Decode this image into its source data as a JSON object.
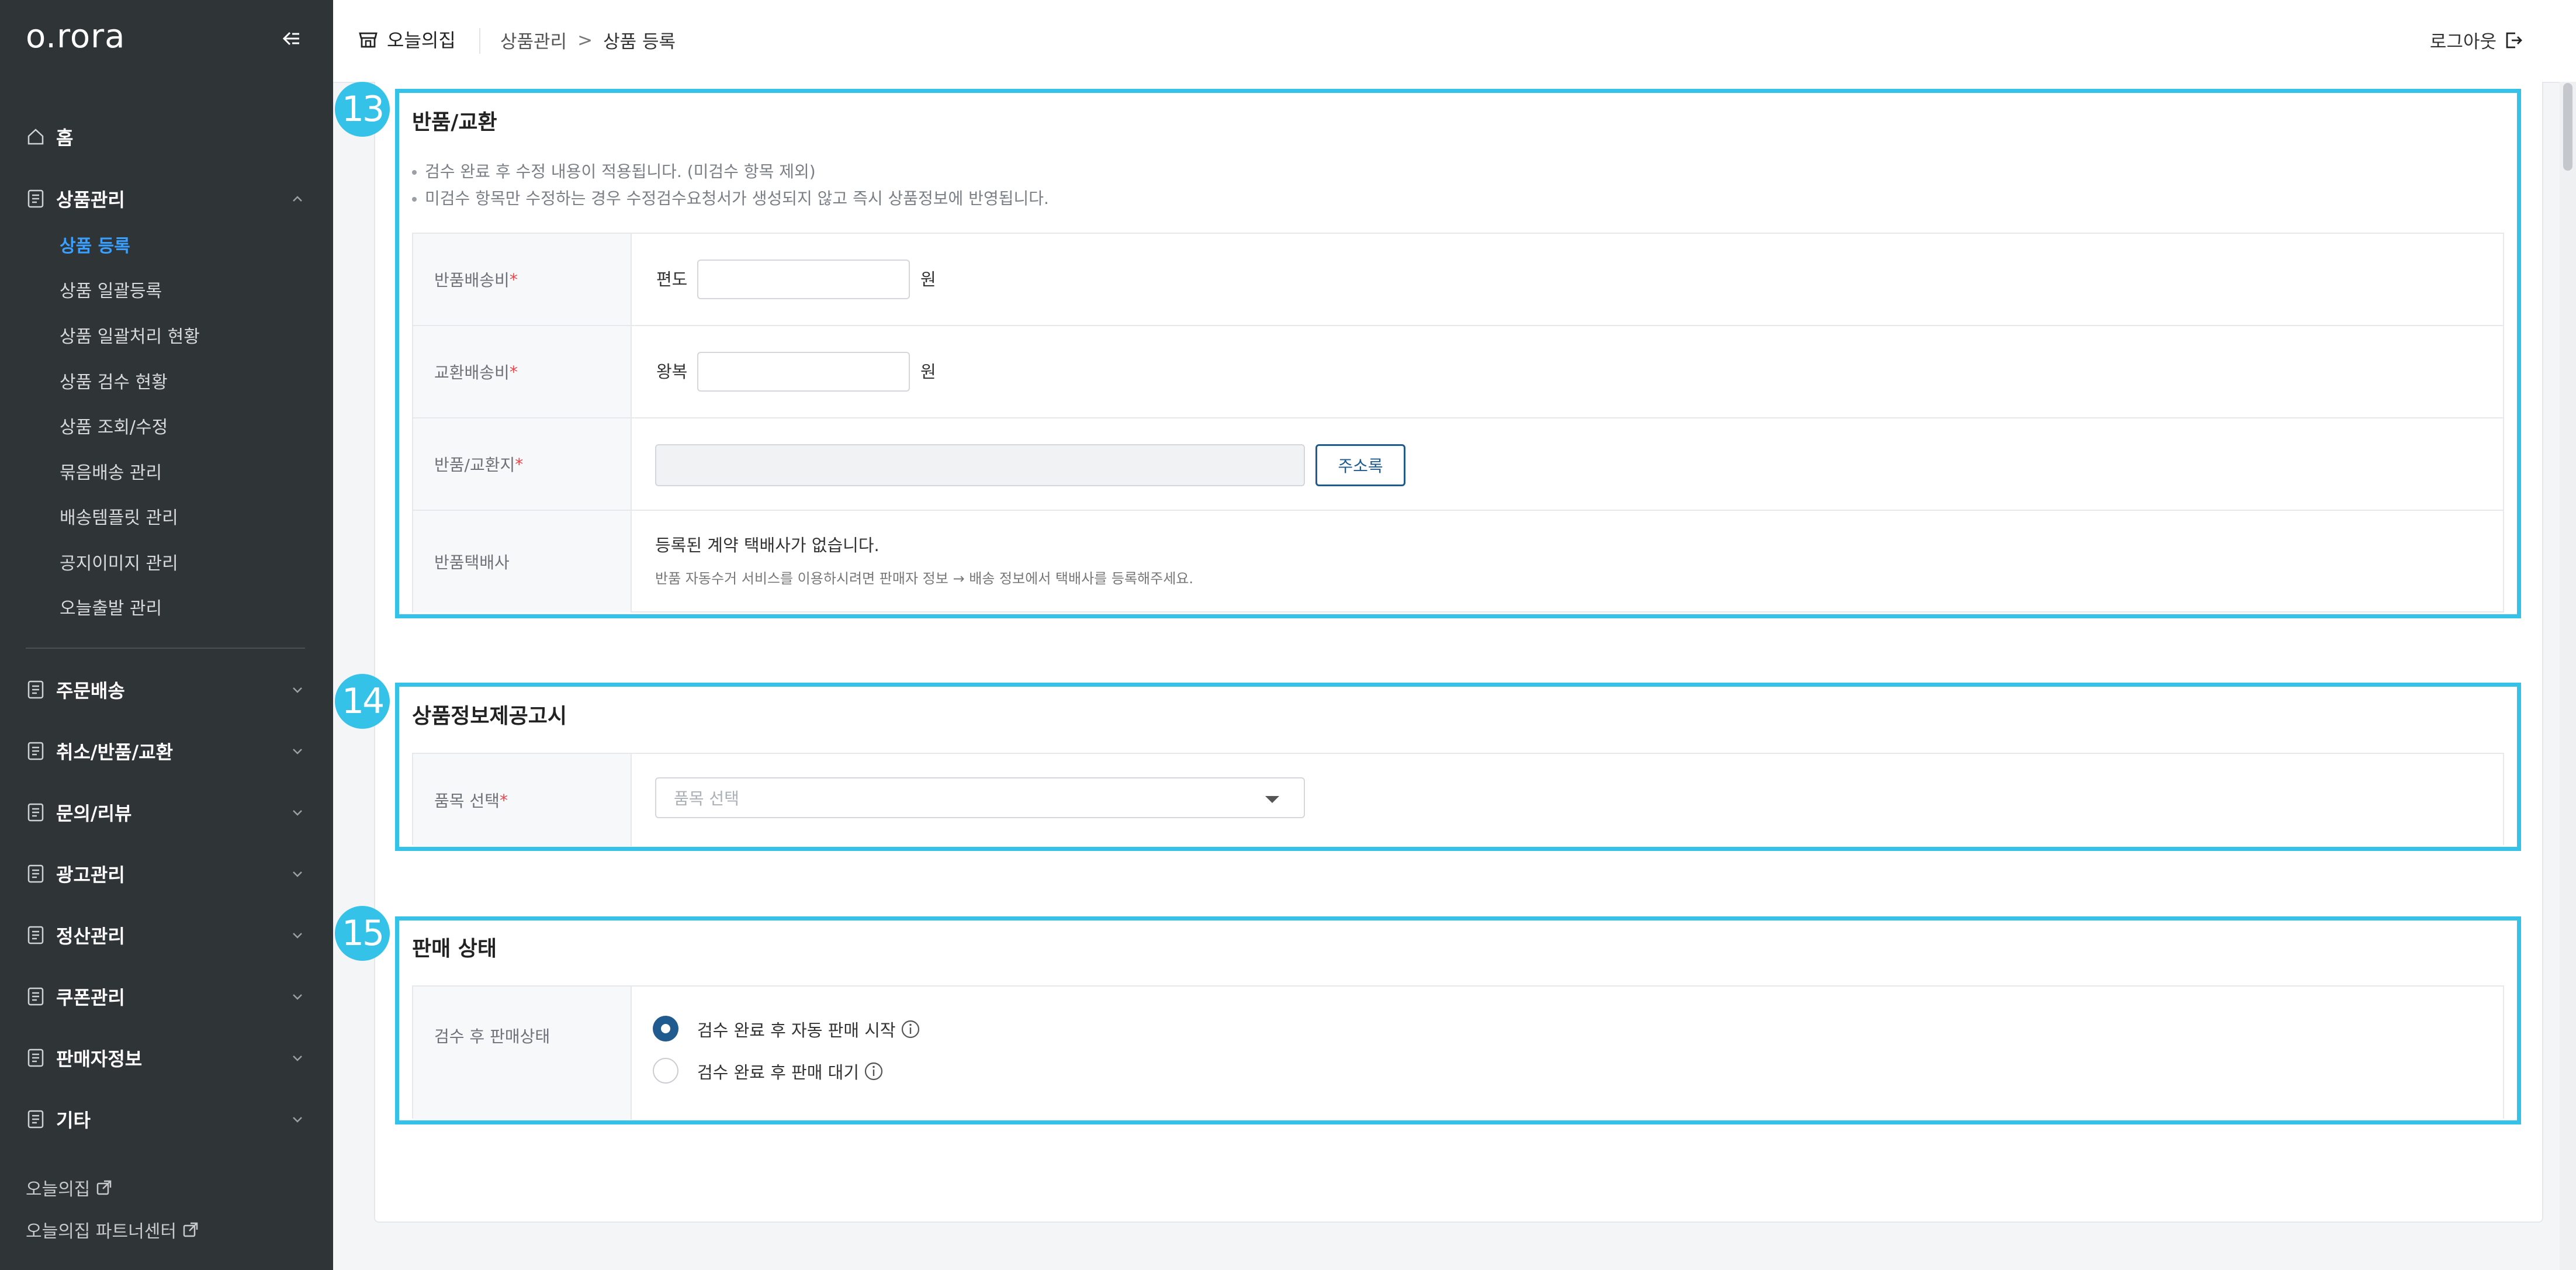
{
  "sidebar": {
    "logo": "o.rora",
    "home": "홈",
    "product_menu": {
      "label": "상품관리",
      "items": [
        {
          "label": "상품 등록",
          "active": true
        },
        {
          "label": "상품 일괄등록"
        },
        {
          "label": "상품 일괄처리 현황"
        },
        {
          "label": "상품 검수 현황"
        },
        {
          "label": "상품 조회/수정"
        },
        {
          "label": "묶음배송 관리"
        },
        {
          "label": "배송템플릿 관리"
        },
        {
          "label": "공지이미지 관리"
        },
        {
          "label": "오늘출발 관리"
        }
      ]
    },
    "menus": [
      "주문배송",
      "취소/반품/교환",
      "문의/리뷰",
      "광고관리",
      "정산관리",
      "쿠폰관리",
      "판매자정보",
      "기타"
    ],
    "links": [
      "오늘의집",
      "오늘의집 파트너센터"
    ]
  },
  "header": {
    "shop_name": "오늘의집",
    "breadcrumb": [
      "상품관리",
      "상품 등록"
    ],
    "breadcrumb_sep": ">",
    "logout": "로그아웃"
  },
  "sections": {
    "return_exchange": {
      "step": "13",
      "title": "반품/교환",
      "notices": [
        "검수 완료 후 수정 내용이 적용됩니다. (미검수 항목 제외)",
        "미검수 항목만 수정하는 경우 수정검수요청서가 생성되지 않고 즉시 상품정보에 반영됩니다."
      ],
      "return_fee": {
        "label": "반품배송비",
        "prefix": "편도",
        "value": "",
        "unit": "원"
      },
      "exchange_fee": {
        "label": "교환배송비",
        "prefix": "왕복",
        "value": "",
        "unit": "원"
      },
      "address": {
        "label": "반품/교환지",
        "value": "",
        "button": "주소록"
      },
      "courier": {
        "label": "반품택배사",
        "message": "등록된 계약 택배사가 없습니다.",
        "help": "반품 자동수거 서비스를 이용하시려면 판매자 정보 → 배송 정보에서 택배사를 등록해주세요."
      }
    },
    "product_info": {
      "step": "14",
      "title": "상품정보제공고시",
      "category": {
        "label": "품목 선택",
        "placeholder": "품목 선택"
      }
    },
    "sale_status": {
      "step": "15",
      "title": "판매 상태",
      "label": "검수 후 판매상태",
      "options": [
        {
          "label": "검수 완료 후 자동 판매 시작",
          "selected": true
        },
        {
          "label": "검수 완료 후 판매 대기",
          "selected": false
        }
      ]
    }
  },
  "colors": {
    "sidebar_bg": "#2f3437",
    "active_menu": "#3aa0ff",
    "highlight": "#35c2e8",
    "primary": "#1f5b8e",
    "required": "#e8464a"
  }
}
